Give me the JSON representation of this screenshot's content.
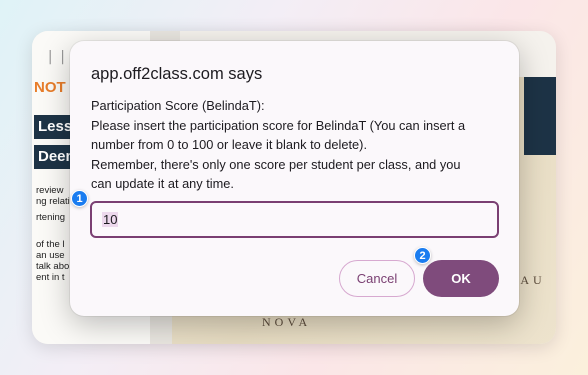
{
  "background": {
    "note_text": "NOT",
    "bar1": "Lesso",
    "bar2": "Deem n",
    "text_lines_1": [
      "review",
      "ng relati"
    ],
    "text_lines_2": [
      "rtening"
    ],
    "text_lines_3": [
      "of the l",
      "an use",
      "talk abo",
      "ent in t"
    ],
    "map_text_1": "NOVA",
    "map_text_2": "A AU"
  },
  "dialog": {
    "title": "app.off2class.com says",
    "message_lines": [
      "Participation Score (BelindaT):",
      "Please insert the participation score for BelindaT (You can insert a",
      "number from 0 to 100 or leave it blank to delete).",
      "Remember, there's only one score per student per class, and you",
      "can update it at any time."
    ],
    "input_value": "10",
    "cancel_label": "Cancel",
    "ok_label": "OK"
  },
  "markers": {
    "m1": "1",
    "m2": "2"
  },
  "colors": {
    "accent": "#7f4b7c",
    "input_border": "#7a3f72",
    "marker": "#1a7cf0"
  }
}
